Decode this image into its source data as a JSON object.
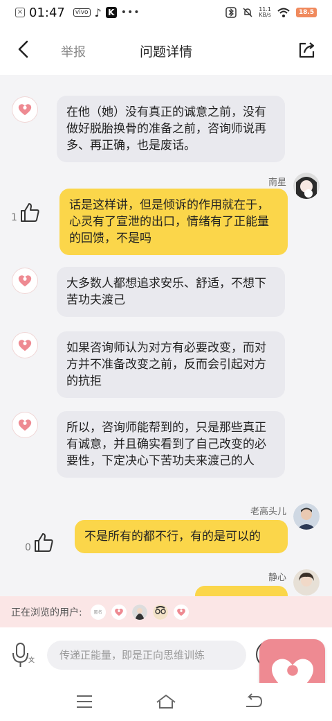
{
  "status_bar": {
    "time": "01:47",
    "app_badge": "vivo",
    "k_label": "K",
    "dots": "•••",
    "net_speed_value": "11.1",
    "net_speed_unit": "KB/s",
    "battery_label": "18.5"
  },
  "nav": {
    "report_label": "举报",
    "title": "问题详情"
  },
  "messages": [
    {
      "type": "bot",
      "text": "在他（她）没有真正的诚意之前，没有做好脱胎换骨的准备之前，咨询师说再多、再正确，也是废话。"
    },
    {
      "type": "user",
      "name": "南星",
      "text": "话是这样讲，但是倾诉的作用就在于，心灵有了宣泄的出口，情绪有了正能量的回馈，不是吗",
      "likes": "1"
    },
    {
      "type": "bot",
      "text": "大多数人都想追求安乐、舒适，不想下苦功夫渡己"
    },
    {
      "type": "bot",
      "text": "如果咨询师认为对方有必要改变，而对方并不准备改变之前，反而会引起对方的抗拒"
    },
    {
      "type": "bot",
      "text": "所以，咨询师能帮到的，只是那些真正有诚意，并且确实看到了自己改变的必要性，下定决心下苦功夫来渡己的人"
    },
    {
      "type": "user",
      "name": "老高头儿",
      "text": "不是所有的都不行，有的是可以的",
      "likes": "0"
    },
    {
      "type": "user",
      "name": "静心",
      "text": ""
    }
  ],
  "browsing": {
    "label": "正在浏览的用户:",
    "anon_label": "匿名"
  },
  "input": {
    "placeholder": "传递正能量，即是正向思维训练",
    "voice_text_badge": "文"
  },
  "colors": {
    "accent_yellow": "#fbd64a",
    "bubble_grey": "#e9e9ee",
    "heart_pink": "#ee8a92",
    "browse_bg": "#fbe6e6"
  },
  "icons": [
    "back-arrow-icon",
    "share-icon",
    "heart-logo-icon",
    "thumbs-up-icon",
    "microphone-icon"
  ]
}
